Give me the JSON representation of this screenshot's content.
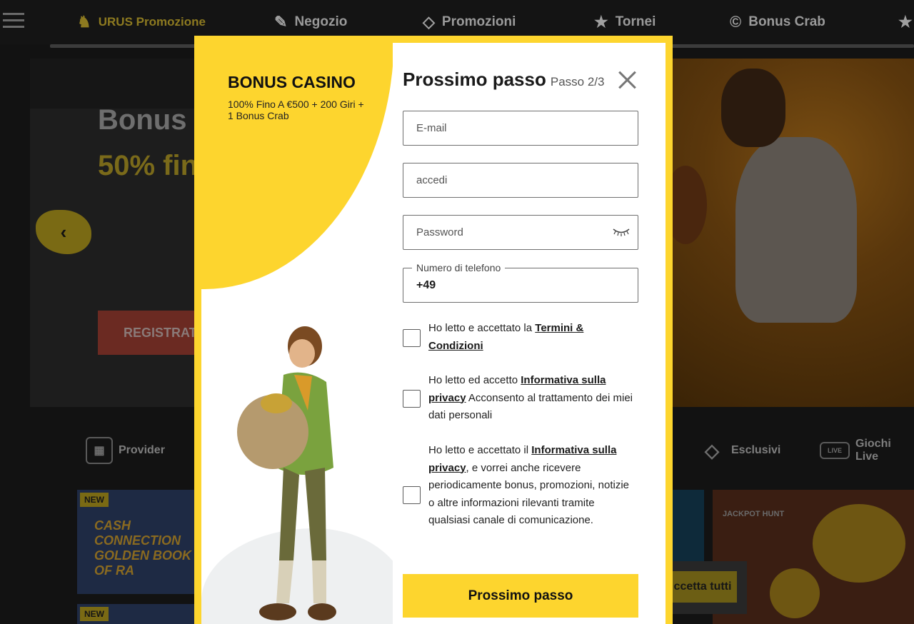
{
  "nav": {
    "items": [
      {
        "label": "URUS Promozione",
        "icon": "bull-icon"
      },
      {
        "label": "Negozio",
        "icon": "ticket-icon"
      },
      {
        "label": "Promozioni",
        "icon": "diamond-icon"
      },
      {
        "label": "Tornei",
        "icon": "star-trophy-icon"
      },
      {
        "label": "Bonus Crab",
        "icon": "crab-c-icon"
      }
    ]
  },
  "hero": {
    "title": "Bonus",
    "subtitle": "50% fin",
    "register_button": "REGISTRAT"
  },
  "categories": [
    {
      "label": "Provider"
    },
    {
      "label": "Esclusivi"
    },
    {
      "label": "Giochi Live"
    }
  ],
  "tiles": {
    "badge_new": "NEW",
    "game1": "CASH CONNECTION GOLDEN BOOK OF RA",
    "jackpot": "JACKPOT HUNT"
  },
  "cookie": {
    "accept": "ccetta tutti"
  },
  "modal": {
    "bonus_title": "BONUS CASINO",
    "bonus_sub": "100% Fino A €500 + 200 Giri + 1 Bonus Crab",
    "title": "Prossimo passo",
    "step": "Passo  2/3",
    "email_placeholder": "E-mail",
    "login_placeholder": "accedi",
    "password_placeholder": "Password",
    "phone_label": "Numero di telefono",
    "phone_prefix": "+49",
    "consent1_pre": "Ho letto e accettato la ",
    "consent1_link": "Termini & Condizioni",
    "consent2_pre": "Ho letto ed accetto ",
    "consent2_link": "Informativa sulla privacy",
    "consent2_post": " Acconsento al trattamento dei miei dati personali",
    "consent3_pre": "Ho letto e accettato il ",
    "consent3_link": "Informativa sulla privacy",
    "consent3_post": ", e vorrei anche ricevere periodicamente bonus, promozioni, notizie o altre informazioni rilevanti tramite qualsiasi canale di comunicazione.",
    "submit": "Prossimo passo"
  },
  "colors": {
    "accent": "#fdd52e",
    "overlay": "#121212"
  }
}
